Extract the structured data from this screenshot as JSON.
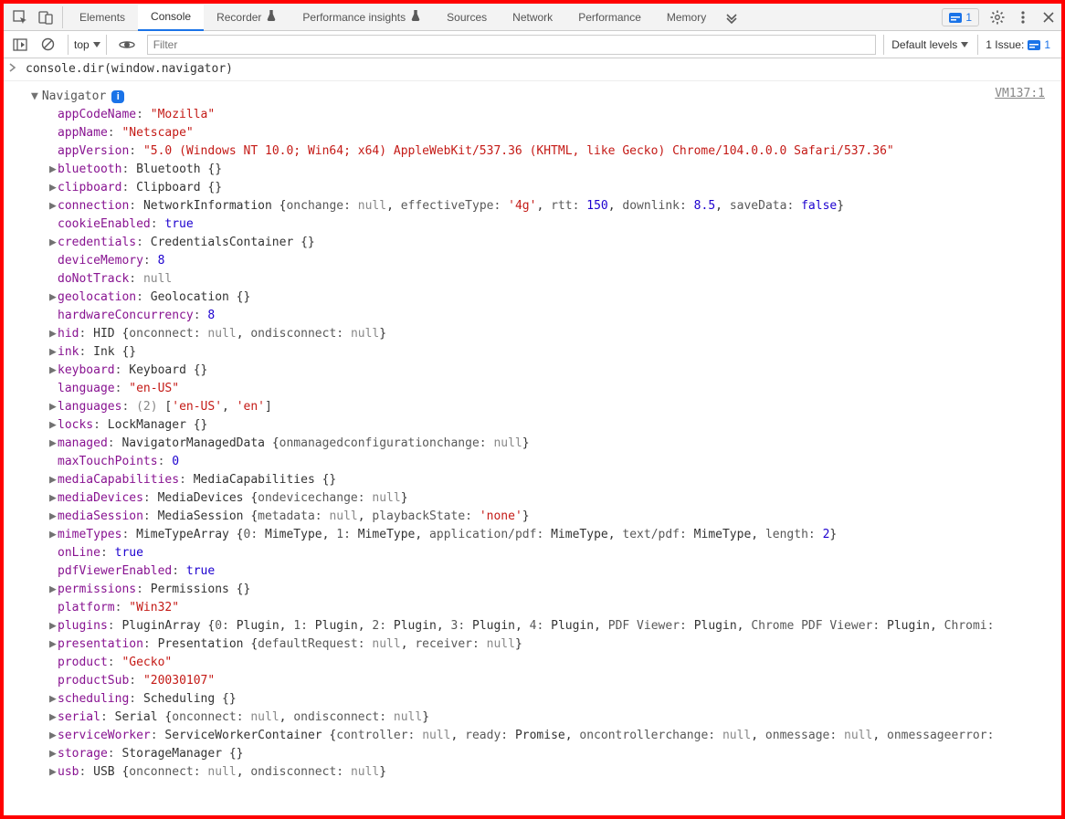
{
  "toolbar": {
    "tabs": [
      "Elements",
      "Console",
      "Recorder",
      "Performance insights",
      "Sources",
      "Network",
      "Performance",
      "Memory"
    ],
    "active_tab": "Console",
    "issue_count": "1"
  },
  "subbar": {
    "context": "top",
    "filter_placeholder": "Filter",
    "levels": "Default levels",
    "issues_label": "1 Issue:",
    "issues_count": "1"
  },
  "console": {
    "command": "console.dir(window.navigator)",
    "vm": "VM137:1",
    "object_label": "Navigator",
    "info_badge": "i",
    "props": [
      {
        "exp": false,
        "key": "appCodeName",
        "str": "\"Mozilla\""
      },
      {
        "exp": false,
        "key": "appName",
        "str": "\"Netscape\""
      },
      {
        "exp": false,
        "key": "appVersion",
        "str": "\"5.0 (Windows NT 10.0; Win64; x64) AppleWebKit/537.36 (KHTML, like Gecko) Chrome/104.0.0.0 Safari/537.36\""
      },
      {
        "exp": true,
        "key": "bluetooth",
        "preview": [
          {
            "t": "val",
            "v": "Bluetooth {}"
          }
        ]
      },
      {
        "exp": true,
        "key": "clipboard",
        "preview": [
          {
            "t": "val",
            "v": "Clipboard {}"
          }
        ]
      },
      {
        "exp": true,
        "key": "connection",
        "preview": [
          {
            "t": "val",
            "v": "NetworkInformation {"
          },
          {
            "t": "pkey",
            "v": "onchange"
          },
          {
            "t": "gray",
            "v": "null"
          },
          {
            "t": "val",
            "v": ", "
          },
          {
            "t": "pkey",
            "v": "effectiveType"
          },
          {
            "t": "str",
            "v": "'4g'"
          },
          {
            "t": "val",
            "v": ", "
          },
          {
            "t": "pkey",
            "v": "rtt"
          },
          {
            "t": "num",
            "v": "150"
          },
          {
            "t": "val",
            "v": ", "
          },
          {
            "t": "pkey",
            "v": "downlink"
          },
          {
            "t": "num",
            "v": "8.5"
          },
          {
            "t": "val",
            "v": ", "
          },
          {
            "t": "pkey",
            "v": "saveData"
          },
          {
            "t": "kw",
            "v": "false"
          },
          {
            "t": "val",
            "v": "}"
          }
        ]
      },
      {
        "exp": false,
        "key": "cookieEnabled",
        "kw": "true"
      },
      {
        "exp": true,
        "key": "credentials",
        "preview": [
          {
            "t": "val",
            "v": "CredentialsContainer {}"
          }
        ]
      },
      {
        "exp": false,
        "key": "deviceMemory",
        "num": "8"
      },
      {
        "exp": false,
        "key": "doNotTrack",
        "gray": "null"
      },
      {
        "exp": true,
        "key": "geolocation",
        "preview": [
          {
            "t": "val",
            "v": "Geolocation {}"
          }
        ]
      },
      {
        "exp": false,
        "key": "hardwareConcurrency",
        "num": "8"
      },
      {
        "exp": true,
        "key": "hid",
        "preview": [
          {
            "t": "val",
            "v": "HID {"
          },
          {
            "t": "pkey",
            "v": "onconnect"
          },
          {
            "t": "gray",
            "v": "null"
          },
          {
            "t": "val",
            "v": ", "
          },
          {
            "t": "pkey",
            "v": "ondisconnect"
          },
          {
            "t": "gray",
            "v": "null"
          },
          {
            "t": "val",
            "v": "}"
          }
        ]
      },
      {
        "exp": true,
        "key": "ink",
        "preview": [
          {
            "t": "val",
            "v": "Ink {}"
          }
        ]
      },
      {
        "exp": true,
        "key": "keyboard",
        "preview": [
          {
            "t": "val",
            "v": "Keyboard {}"
          }
        ]
      },
      {
        "exp": false,
        "key": "language",
        "str": "\"en-US\""
      },
      {
        "exp": true,
        "key": "languages",
        "preview": [
          {
            "t": "gray",
            "v": "(2) "
          },
          {
            "t": "val",
            "v": "["
          },
          {
            "t": "str",
            "v": "'en-US'"
          },
          {
            "t": "val",
            "v": ", "
          },
          {
            "t": "str",
            "v": "'en'"
          },
          {
            "t": "val",
            "v": "]"
          }
        ]
      },
      {
        "exp": true,
        "key": "locks",
        "preview": [
          {
            "t": "val",
            "v": "LockManager {}"
          }
        ]
      },
      {
        "exp": true,
        "key": "managed",
        "preview": [
          {
            "t": "val",
            "v": "NavigatorManagedData {"
          },
          {
            "t": "pkey",
            "v": "onmanagedconfigurationchange"
          },
          {
            "t": "gray",
            "v": "null"
          },
          {
            "t": "val",
            "v": "}"
          }
        ]
      },
      {
        "exp": false,
        "key": "maxTouchPoints",
        "num": "0"
      },
      {
        "exp": true,
        "key": "mediaCapabilities",
        "preview": [
          {
            "t": "val",
            "v": "MediaCapabilities {}"
          }
        ]
      },
      {
        "exp": true,
        "key": "mediaDevices",
        "preview": [
          {
            "t": "val",
            "v": "MediaDevices {"
          },
          {
            "t": "pkey",
            "v": "ondevicechange"
          },
          {
            "t": "gray",
            "v": "null"
          },
          {
            "t": "val",
            "v": "}"
          }
        ]
      },
      {
        "exp": true,
        "key": "mediaSession",
        "preview": [
          {
            "t": "val",
            "v": "MediaSession {"
          },
          {
            "t": "pkey",
            "v": "metadata"
          },
          {
            "t": "gray",
            "v": "null"
          },
          {
            "t": "val",
            "v": ", "
          },
          {
            "t": "pkey",
            "v": "playbackState"
          },
          {
            "t": "str",
            "v": "'none'"
          },
          {
            "t": "val",
            "v": "}"
          }
        ]
      },
      {
        "exp": true,
        "key": "mimeTypes",
        "preview": [
          {
            "t": "val",
            "v": "MimeTypeArray {"
          },
          {
            "t": "pkey",
            "v": "0"
          },
          {
            "t": "val",
            "v": "MimeType, "
          },
          {
            "t": "pkey",
            "v": "1"
          },
          {
            "t": "val",
            "v": "MimeType, "
          },
          {
            "t": "pkey",
            "v": "application/pdf"
          },
          {
            "t": "val",
            "v": "MimeType, "
          },
          {
            "t": "pkey",
            "v": "text/pdf"
          },
          {
            "t": "val",
            "v": "MimeType, "
          },
          {
            "t": "pkey",
            "v": "length"
          },
          {
            "t": "num",
            "v": "2"
          },
          {
            "t": "val",
            "v": "}"
          }
        ]
      },
      {
        "exp": false,
        "key": "onLine",
        "kw": "true"
      },
      {
        "exp": false,
        "key": "pdfViewerEnabled",
        "kw": "true"
      },
      {
        "exp": true,
        "key": "permissions",
        "preview": [
          {
            "t": "val",
            "v": "Permissions {}"
          }
        ]
      },
      {
        "exp": false,
        "key": "platform",
        "str": "\"Win32\""
      },
      {
        "exp": true,
        "key": "plugins",
        "preview": [
          {
            "t": "val",
            "v": "PluginArray {"
          },
          {
            "t": "pkey",
            "v": "0"
          },
          {
            "t": "val",
            "v": "Plugin, "
          },
          {
            "t": "pkey",
            "v": "1"
          },
          {
            "t": "val",
            "v": "Plugin, "
          },
          {
            "t": "pkey",
            "v": "2"
          },
          {
            "t": "val",
            "v": "Plugin, "
          },
          {
            "t": "pkey",
            "v": "3"
          },
          {
            "t": "val",
            "v": "Plugin, "
          },
          {
            "t": "pkey",
            "v": "4"
          },
          {
            "t": "val",
            "v": "Plugin, "
          },
          {
            "t": "pkey",
            "v": "PDF Viewer"
          },
          {
            "t": "val",
            "v": "Plugin, "
          },
          {
            "t": "pkey",
            "v": "Chrome PDF Viewer"
          },
          {
            "t": "val",
            "v": "Plugin, "
          },
          {
            "t": "pkey",
            "v": "Chromi"
          }
        ]
      },
      {
        "exp": true,
        "key": "presentation",
        "preview": [
          {
            "t": "val",
            "v": "Presentation {"
          },
          {
            "t": "pkey",
            "v": "defaultRequest"
          },
          {
            "t": "gray",
            "v": "null"
          },
          {
            "t": "val",
            "v": ", "
          },
          {
            "t": "pkey",
            "v": "receiver"
          },
          {
            "t": "gray",
            "v": "null"
          },
          {
            "t": "val",
            "v": "}"
          }
        ]
      },
      {
        "exp": false,
        "key": "product",
        "str": "\"Gecko\""
      },
      {
        "exp": false,
        "key": "productSub",
        "str": "\"20030107\""
      },
      {
        "exp": true,
        "key": "scheduling",
        "preview": [
          {
            "t": "val",
            "v": "Scheduling {}"
          }
        ]
      },
      {
        "exp": true,
        "key": "serial",
        "preview": [
          {
            "t": "val",
            "v": "Serial {"
          },
          {
            "t": "pkey",
            "v": "onconnect"
          },
          {
            "t": "gray",
            "v": "null"
          },
          {
            "t": "val",
            "v": ", "
          },
          {
            "t": "pkey",
            "v": "ondisconnect"
          },
          {
            "t": "gray",
            "v": "null"
          },
          {
            "t": "val",
            "v": "}"
          }
        ]
      },
      {
        "exp": true,
        "key": "serviceWorker",
        "preview": [
          {
            "t": "val",
            "v": "ServiceWorkerContainer {"
          },
          {
            "t": "pkey",
            "v": "controller"
          },
          {
            "t": "gray",
            "v": "null"
          },
          {
            "t": "val",
            "v": ", "
          },
          {
            "t": "pkey",
            "v": "ready"
          },
          {
            "t": "val",
            "v": "Promise, "
          },
          {
            "t": "pkey",
            "v": "oncontrollerchange"
          },
          {
            "t": "gray",
            "v": "null"
          },
          {
            "t": "val",
            "v": ", "
          },
          {
            "t": "pkey",
            "v": "onmessage"
          },
          {
            "t": "gray",
            "v": "null"
          },
          {
            "t": "val",
            "v": ", "
          },
          {
            "t": "pkey",
            "v": "onmessageerror"
          }
        ]
      },
      {
        "exp": true,
        "key": "storage",
        "preview": [
          {
            "t": "val",
            "v": "StorageManager {}"
          }
        ]
      },
      {
        "exp": true,
        "key": "usb",
        "preview": [
          {
            "t": "val",
            "v": "USB {"
          },
          {
            "t": "pkey",
            "v": "onconnect"
          },
          {
            "t": "gray",
            "v": "null"
          },
          {
            "t": "val",
            "v": ", "
          },
          {
            "t": "pkey",
            "v": "ondisconnect"
          },
          {
            "t": "gray",
            "v": "null"
          },
          {
            "t": "val",
            "v": "}"
          }
        ]
      }
    ]
  }
}
